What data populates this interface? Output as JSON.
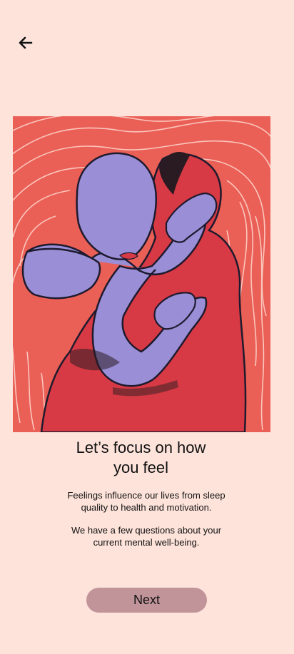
{
  "header": {
    "back_icon": "arrow-left-icon"
  },
  "artwork": {
    "description_icon": "embrace-painting",
    "colors": {
      "background": "#ea5f56",
      "figure_blue": "#9a8fd6",
      "figure_red": "#d83a45",
      "outline": "#1e1a2e",
      "contour_lines": "#ffd9cf"
    }
  },
  "content": {
    "title_line_1": "Let’s focus on how",
    "title_line_2": "you feel",
    "para1_line_1": "Feelings influence our lives from sleep",
    "para1_line_2": "quality to health and motivation.",
    "para2_line_1": "We have a few questions about your",
    "para2_line_2": "current mental well-being."
  },
  "actions": {
    "next_label": "Next"
  },
  "colors": {
    "page_background": "#fde3da",
    "button_background": "#c1949a",
    "text": "#111111"
  }
}
